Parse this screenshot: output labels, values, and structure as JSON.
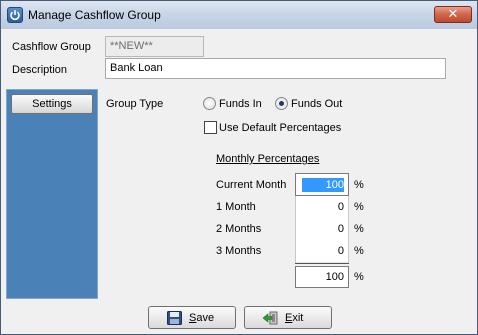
{
  "window": {
    "title": "Manage Cashflow Group"
  },
  "form": {
    "cashflow_group_label": "Cashflow Group",
    "cashflow_group_value": "**NEW**",
    "description_label": "Description",
    "description_value": "Bank Loan"
  },
  "sidebar": {
    "settings_label": "Settings"
  },
  "group_type": {
    "label": "Group Type",
    "options": [
      {
        "label": "Funds In",
        "selected": false
      },
      {
        "label": "Funds Out",
        "selected": true
      }
    ]
  },
  "use_default": {
    "label": "Use Default Percentages",
    "checked": false
  },
  "monthly": {
    "heading": "Monthly Percentages",
    "rows": [
      {
        "label": "Current Month",
        "value": "100",
        "unit": "%"
      },
      {
        "label": "1 Month",
        "value": "0",
        "unit": "%"
      },
      {
        "label": "2 Months",
        "value": "0",
        "unit": "%"
      },
      {
        "label": "3 Months",
        "value": "0",
        "unit": "%"
      }
    ],
    "total": {
      "value": "100",
      "unit": "%"
    }
  },
  "buttons": {
    "save_first": "S",
    "save_rest": "ave",
    "exit_first": "E",
    "exit_rest": "xit"
  },
  "icons": {
    "app": "power-icon",
    "close": "close-icon",
    "save": "floppy-disk-icon",
    "exit": "exit-door-icon"
  },
  "colors": {
    "sidebar": "#4a82b8",
    "selection": "#3399ff",
    "close_button": "#c75a3f"
  }
}
